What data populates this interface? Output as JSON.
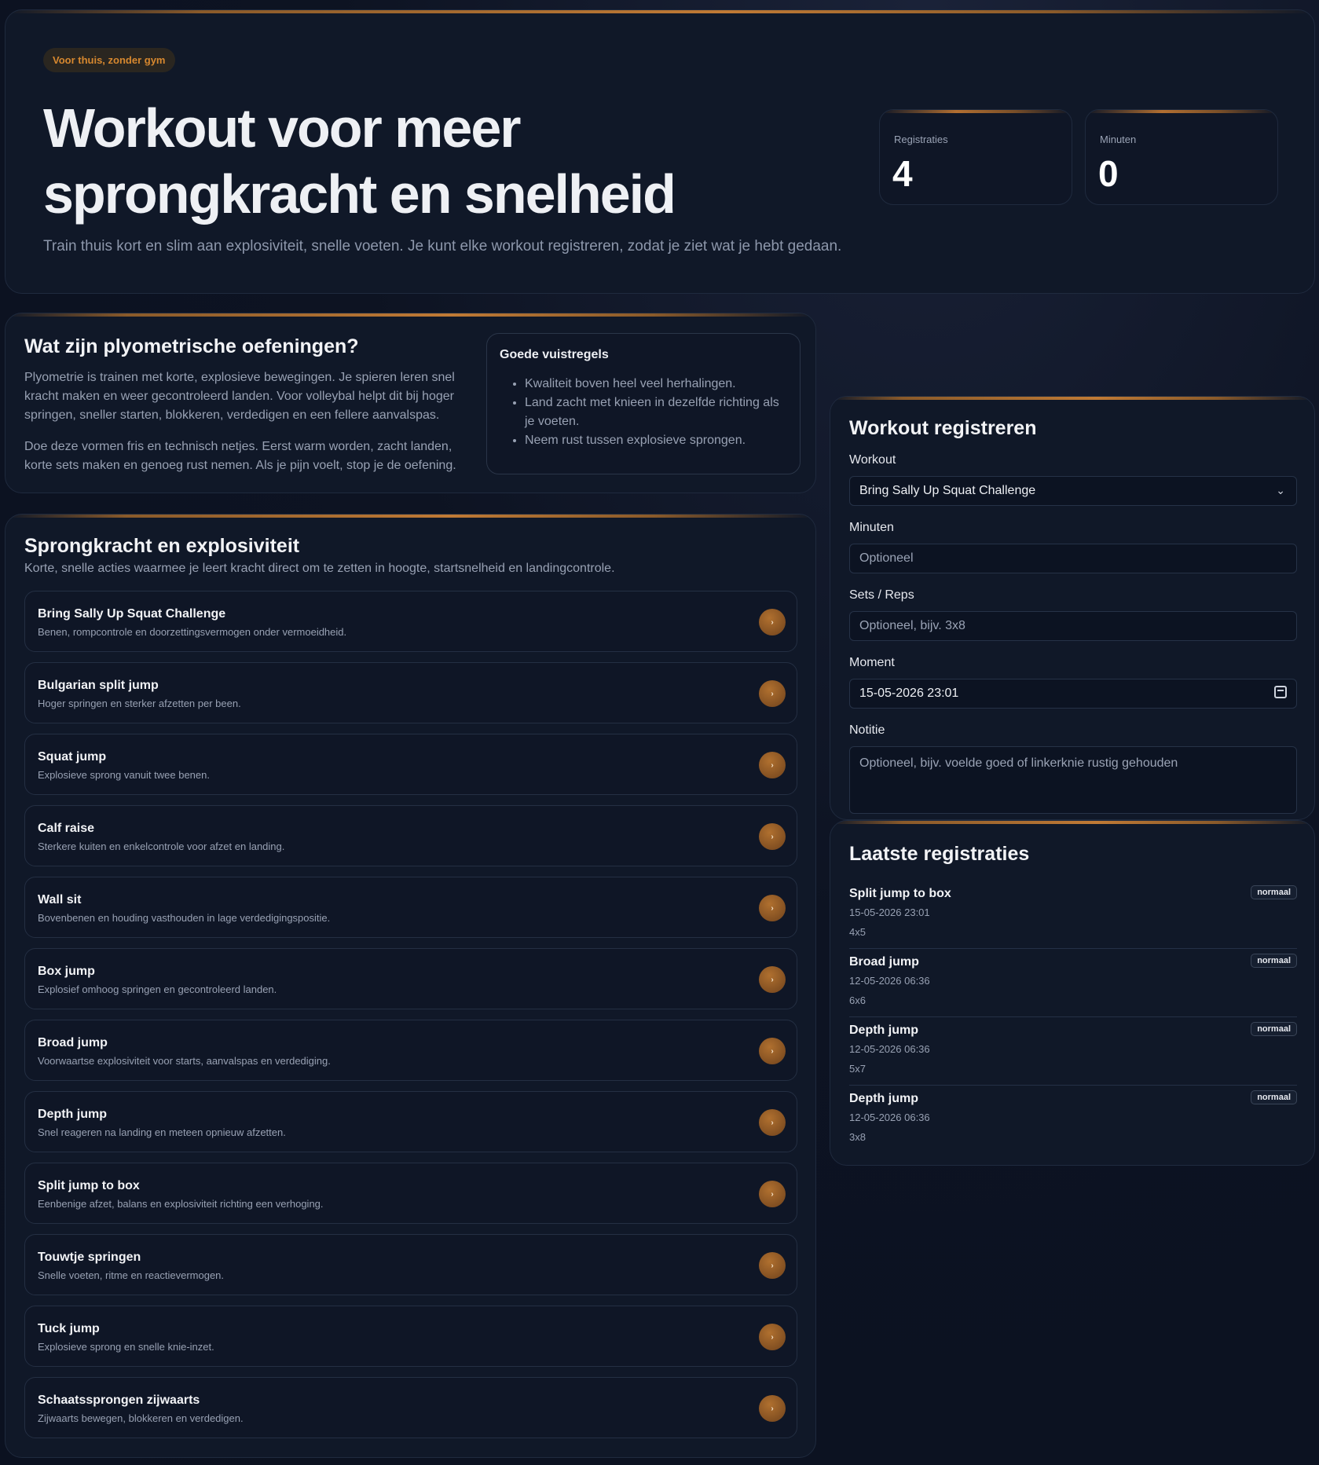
{
  "hero": {
    "badge": "Voor thuis, zonder gym",
    "title": "Workout voor meer sprongkracht en snelheid",
    "subtitle": "Train thuis kort en slim aan explosiviteit, snelle voeten. Je kunt elke workout registreren, zodat je ziet wat je hebt gedaan.",
    "stats": [
      {
        "label": "Registraties",
        "value": "4"
      },
      {
        "label": "Minuten",
        "value": "0"
      }
    ]
  },
  "info": {
    "title": "Wat zijn plyometrische oefeningen?",
    "p1": "Plyometrie is trainen met korte, explosieve bewegingen. Je spieren leren snel kracht maken en weer gecontroleerd landen. Voor volleybal helpt dit bij hoger springen, sneller starten, blokkeren, verdedigen en een fellere aanvalspas.",
    "p2": "Doe deze vormen fris en technisch netjes. Eerst warm worden, zacht landen, korte sets maken en genoeg rust nemen. Als je pijn voelt, stop je de oefening.",
    "rules": {
      "title": "Goede vuistregels",
      "items": [
        "Kwaliteit boven heel veel herhalingen.",
        "Land zacht met knieen in dezelfde richting als je voeten.",
        "Neem rust tussen explosieve sprongen."
      ]
    }
  },
  "exercises": {
    "title": "Sprongkracht en explosiviteit",
    "subtitle": "Korte, snelle acties waarmee je leert kracht direct om te zetten in hoogte, startsnelheid en landingcontrole.",
    "arrow": "›",
    "items": [
      {
        "title": "Bring Sally Up Squat Challenge",
        "desc": "Benen, rompcontrole en doorzettingsvermogen onder vermoeidheid."
      },
      {
        "title": "Bulgarian split jump",
        "desc": "Hoger springen en sterker afzetten per been."
      },
      {
        "title": "Squat jump",
        "desc": "Explosieve sprong vanuit twee benen."
      },
      {
        "title": "Calf raise",
        "desc": "Sterkere kuiten en enkelcontrole voor afzet en landing."
      },
      {
        "title": "Wall sit",
        "desc": "Bovenbenen en houding vasthouden in lage verdedigingspositie."
      },
      {
        "title": "Box jump",
        "desc": "Explosief omhoog springen en gecontroleerd landen."
      },
      {
        "title": "Broad jump",
        "desc": "Voorwaartse explosiviteit voor starts, aanvalspas en verdediging."
      },
      {
        "title": "Depth jump",
        "desc": "Snel reageren na landing en meteen opnieuw afzetten."
      },
      {
        "title": "Split jump to box",
        "desc": "Eenbenige afzet, balans en explosiviteit richting een verhoging."
      },
      {
        "title": "Touwtje springen",
        "desc": "Snelle voeten, ritme en reactievermogen."
      },
      {
        "title": "Tuck jump",
        "desc": "Explosieve sprong en snelle knie-inzet."
      },
      {
        "title": "Schaatssprongen zijwaarts",
        "desc": "Zijwaarts bewegen, blokkeren en verdedigen."
      }
    ]
  },
  "form": {
    "title": "Workout registreren",
    "workout_label": "Workout",
    "workout_value": "Bring Sally Up Squat Challenge",
    "minutes_label": "Minuten",
    "minutes_placeholder": "Optioneel",
    "sets_label": "Sets / Reps",
    "sets_placeholder": "Optioneel, bijv. 3x8",
    "moment_label": "Moment",
    "moment_value": "15-05-2026 23:01",
    "note_label": "Notitie",
    "note_placeholder": "Optioneel, bijv. voelde goed of linkerknie rustig gehouden"
  },
  "recent": {
    "title": "Laatste registraties",
    "items": [
      {
        "name": "Split jump to box",
        "datetime": "15-05-2026 23:01",
        "sets": "4x5",
        "tag": "normaal"
      },
      {
        "name": "Broad jump",
        "datetime": "12-05-2026 06:36",
        "sets": "6x6",
        "tag": "normaal"
      },
      {
        "name": "Depth jump",
        "datetime": "12-05-2026 06:36",
        "sets": "5x7",
        "tag": "normaal"
      },
      {
        "name": "Depth jump",
        "datetime": "12-05-2026 06:36",
        "sets": "3x8",
        "tag": "normaal"
      }
    ]
  },
  "colors": {
    "accent": "#c07a35",
    "background": "#0d1322",
    "card": "#101828"
  }
}
